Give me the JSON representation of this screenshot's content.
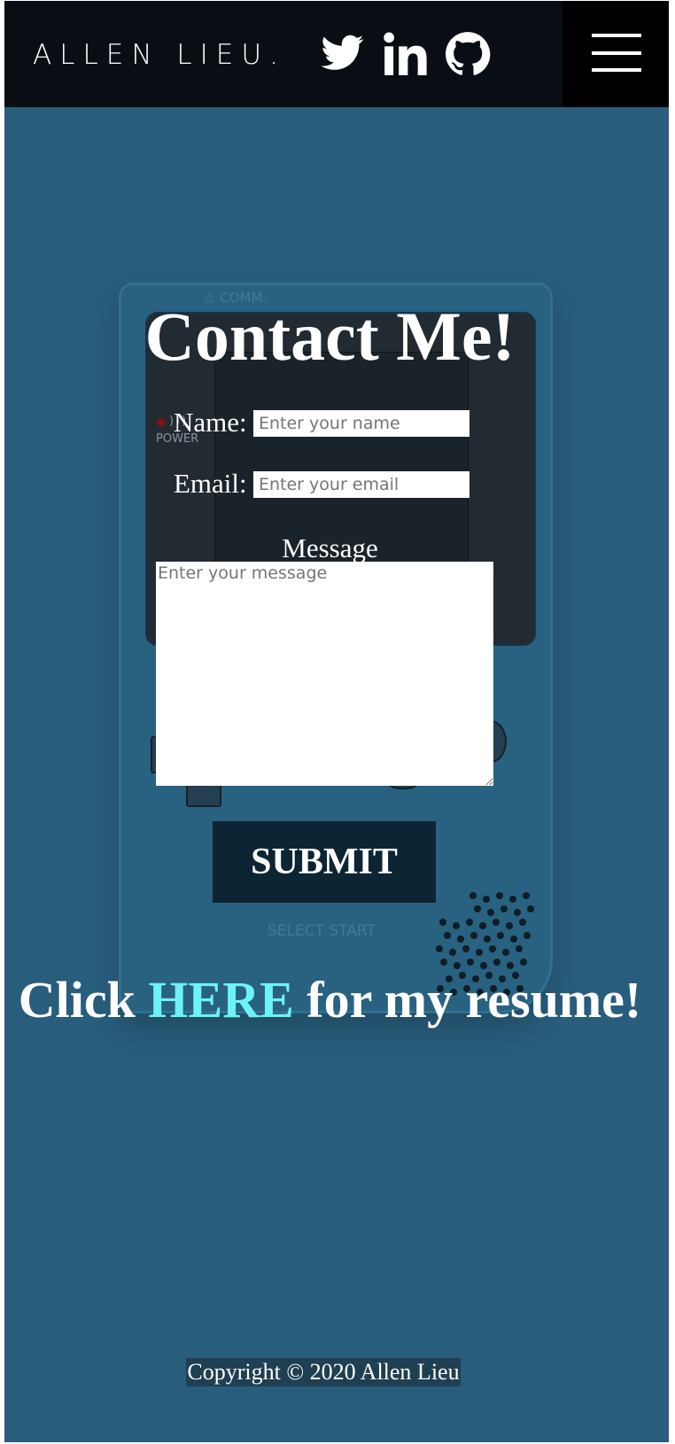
{
  "header": {
    "brand": "ALLEN LIEU.",
    "social": [
      {
        "icon": "twitter-icon"
      },
      {
        "icon": "linkedin-icon"
      },
      {
        "icon": "github-icon"
      }
    ],
    "menu_icon": "hamburger-menu-icon"
  },
  "device": {
    "comm_label": "⚠ COMM.",
    "power_label": "POWER",
    "select_start_label": "SELECT  START"
  },
  "contact": {
    "title": "Contact Me!",
    "name_label": "Name:",
    "name_placeholder": "Enter your name",
    "email_label": "Email:",
    "email_placeholder": "Enter your email",
    "message_label": "Message",
    "message_placeholder": "Enter your message",
    "submit_label": "SUBMIT"
  },
  "resume": {
    "prefix": "Click ",
    "link_text": "HERE",
    "suffix": " for my resume!"
  },
  "footer": {
    "copyright": "Copyright © 2020 Allen Lieu"
  },
  "colors": {
    "background": "#285d7c",
    "header_bg": "#080e13",
    "link_accent": "#6cf3f5",
    "submit_bg": "#0d2532"
  }
}
